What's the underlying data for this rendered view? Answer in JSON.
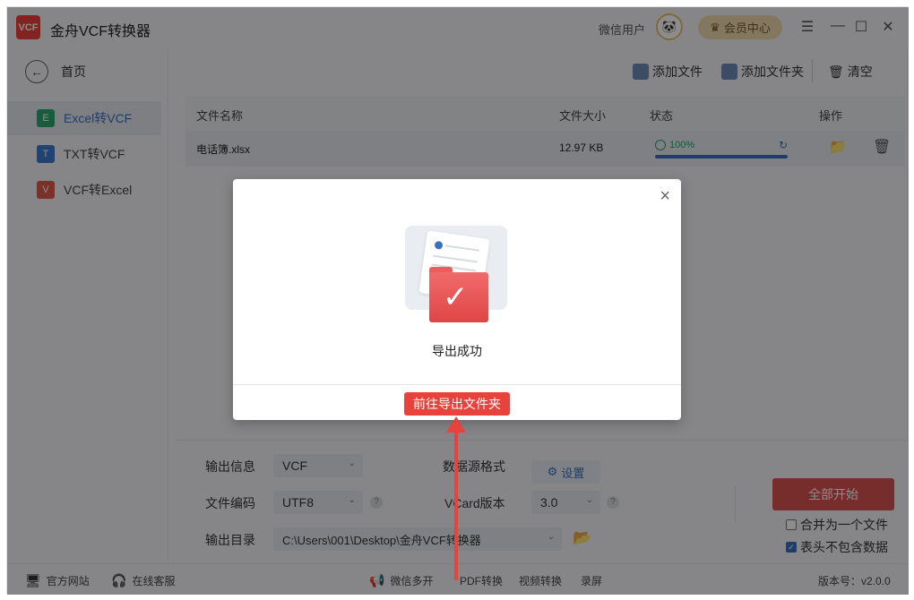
{
  "app": {
    "title": "金舟VCF转换器",
    "logo_text": "VCF",
    "user_name": "微信用户",
    "member_center": "会员中心",
    "controls": [
      "☰",
      "—",
      "☐",
      "✕"
    ]
  },
  "sidebar": {
    "home_label": "首页",
    "items": [
      {
        "badge": "E",
        "label": "Excel转VCF",
        "color": "#2aa872",
        "active": true
      },
      {
        "badge": "T",
        "label": "TXT转VCF",
        "color": "#3b7bd0",
        "active": false
      },
      {
        "badge": "V",
        "label": "VCF转Excel",
        "color": "#e05a4a",
        "active": false
      }
    ]
  },
  "toolbar": {
    "add_file": "添加文件",
    "add_folder": "添加文件夹",
    "clear": "清空"
  },
  "table": {
    "headers": {
      "name": "文件名称",
      "size": "文件大小",
      "status": "状态",
      "ops": "操作"
    },
    "rows": [
      {
        "name": "电话簿.xlsx",
        "size": "12.97 KB",
        "status": "100%",
        "progress": 1.0
      }
    ]
  },
  "settings": {
    "output_info_label": "输出信息",
    "output_info_value": "VCF",
    "encoding_label": "文件编码",
    "encoding_value": "UTF8",
    "output_dir_label": "输出目录",
    "output_dir_value": "C:\\Users\\001\\Desktop\\金舟VCF转换器",
    "source_format_label": "数据源格式",
    "settings_button": "设置",
    "vcard_label": "VCard版本",
    "vcard_value": "3.0",
    "start_all": "全部开始",
    "merge_label": "合并为一个文件",
    "merge_checked": false,
    "header_label": "表头不包含数据",
    "header_checked": true
  },
  "footer": {
    "official_site": "官方网站",
    "online_service": "在线客服",
    "wechat_multi": "微信多开",
    "pdf_convert": "PDF转换",
    "video_convert": "视频转换",
    "record": "录屏",
    "version": "版本号：v2.0.0"
  },
  "dialog": {
    "message": "导出成功",
    "goto_button": "前往导出文件夹"
  }
}
